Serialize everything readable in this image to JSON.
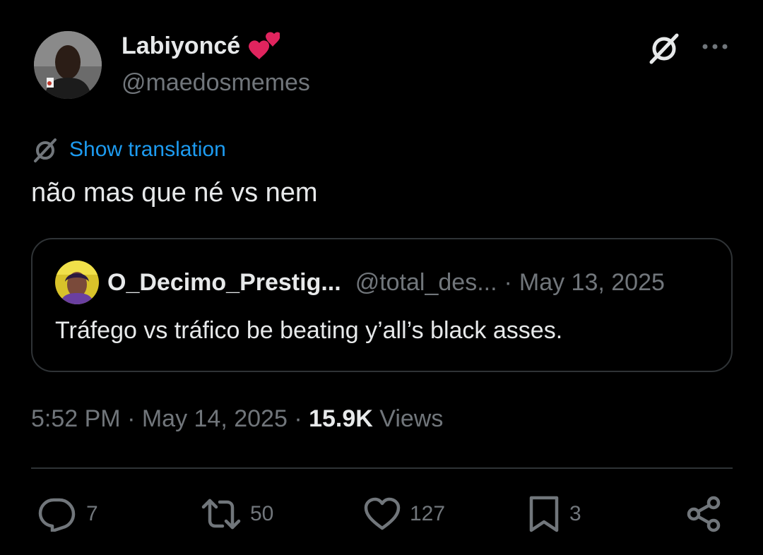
{
  "author": {
    "display_name": "Labiyoncé",
    "emoji": "heart-exclamation-emoji",
    "handle": "@maedosmemes"
  },
  "translation": {
    "label": "Show translation"
  },
  "tweet": {
    "text": "não mas que né vs nem"
  },
  "quote": {
    "display_name": "O_Decimo_Prestig...",
    "handle": "@total_des...",
    "separator": "·",
    "date": "May 13, 2025",
    "text": "Tráfego vs tráfico be beating y’all’s black asses."
  },
  "meta": {
    "time": "5:52 PM",
    "sep1": " · ",
    "date": "May 14, 2025",
    "sep2": " · ",
    "views_count": "15.9K",
    "views_label": " Views"
  },
  "actions": {
    "replies": "7",
    "reposts": "50",
    "likes": "127",
    "bookmarks": "3"
  },
  "colors": {
    "background": "#000000",
    "text": "#e7e9ea",
    "secondary": "#71767b",
    "link": "#1d9bf0",
    "border": "#2f3336",
    "heart": "#e0245e"
  }
}
